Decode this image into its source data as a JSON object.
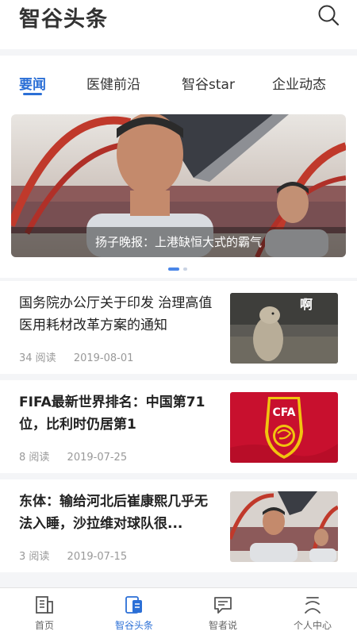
{
  "header": {
    "title": "智谷头条"
  },
  "tabs": [
    {
      "label": "要闻",
      "active": true
    },
    {
      "label": "医健前沿",
      "active": false
    },
    {
      "label": "智谷star",
      "active": false
    },
    {
      "label": "企业动态",
      "active": false
    }
  ],
  "banner": {
    "caption": "扬子晚报：上港缺恒大式的霸气",
    "page_count": 2,
    "current_page": 1
  },
  "articles": [
    {
      "title": "国务院办公厅关于印发 治理高值医用耗材改革方案的通知",
      "reads": "34 阅读",
      "date": "2019-08-01",
      "thumb": "marmot-photo",
      "thumb_text": "啊"
    },
    {
      "title": "FIFA最新世界排名：中国第71位，比利时仍居第1",
      "reads": "8 阅读",
      "date": "2019-07-25",
      "thumb": "cfa-logo",
      "thumb_text": "CFA"
    },
    {
      "title": "东体：输给河北后崔康熙几乎无法入睡，沙拉维对球队很...",
      "reads": "3 阅读",
      "date": "2019-07-15",
      "thumb": "coach-photo"
    }
  ],
  "bottom_nav": [
    {
      "label": "首页",
      "icon": "home-building-icon",
      "active": false
    },
    {
      "label": "智谷头条",
      "icon": "news-icon",
      "active": true
    },
    {
      "label": "智者说",
      "icon": "chat-bubble-icon",
      "active": false
    },
    {
      "label": "个人中心",
      "icon": "person-icon",
      "active": false
    }
  ],
  "colors": {
    "accent": "#2b6fd6",
    "background": "#f4f5f7",
    "meta_text": "#999999"
  }
}
